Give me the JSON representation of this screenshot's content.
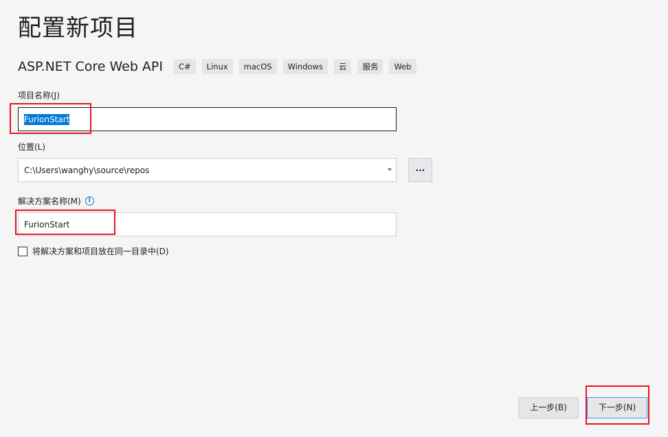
{
  "page": {
    "title": "配置新项目"
  },
  "template": {
    "name": "ASP.NET Core Web API",
    "tags": [
      "C#",
      "Linux",
      "macOS",
      "Windows",
      "云",
      "服务",
      "Web"
    ]
  },
  "project_name": {
    "label": "项目名称(J)",
    "value": "FurionStart"
  },
  "location": {
    "label": "位置(L)",
    "value": "C:\\Users\\wanghy\\source\\repos",
    "browse_label": "..."
  },
  "solution_name": {
    "label": "解决方案名称(M)",
    "value": "FurionStart",
    "info_icon": "info-icon"
  },
  "same_directory": {
    "label": "将解决方案和项目放在同一目录中(D)",
    "checked": false
  },
  "footer": {
    "back_label": "上一步(B)",
    "next_label": "下一步(N)"
  },
  "colors": {
    "background": "#f5f5f5",
    "selection": "#0078d7",
    "annotation": "#e81123",
    "info": "#1e73be"
  }
}
